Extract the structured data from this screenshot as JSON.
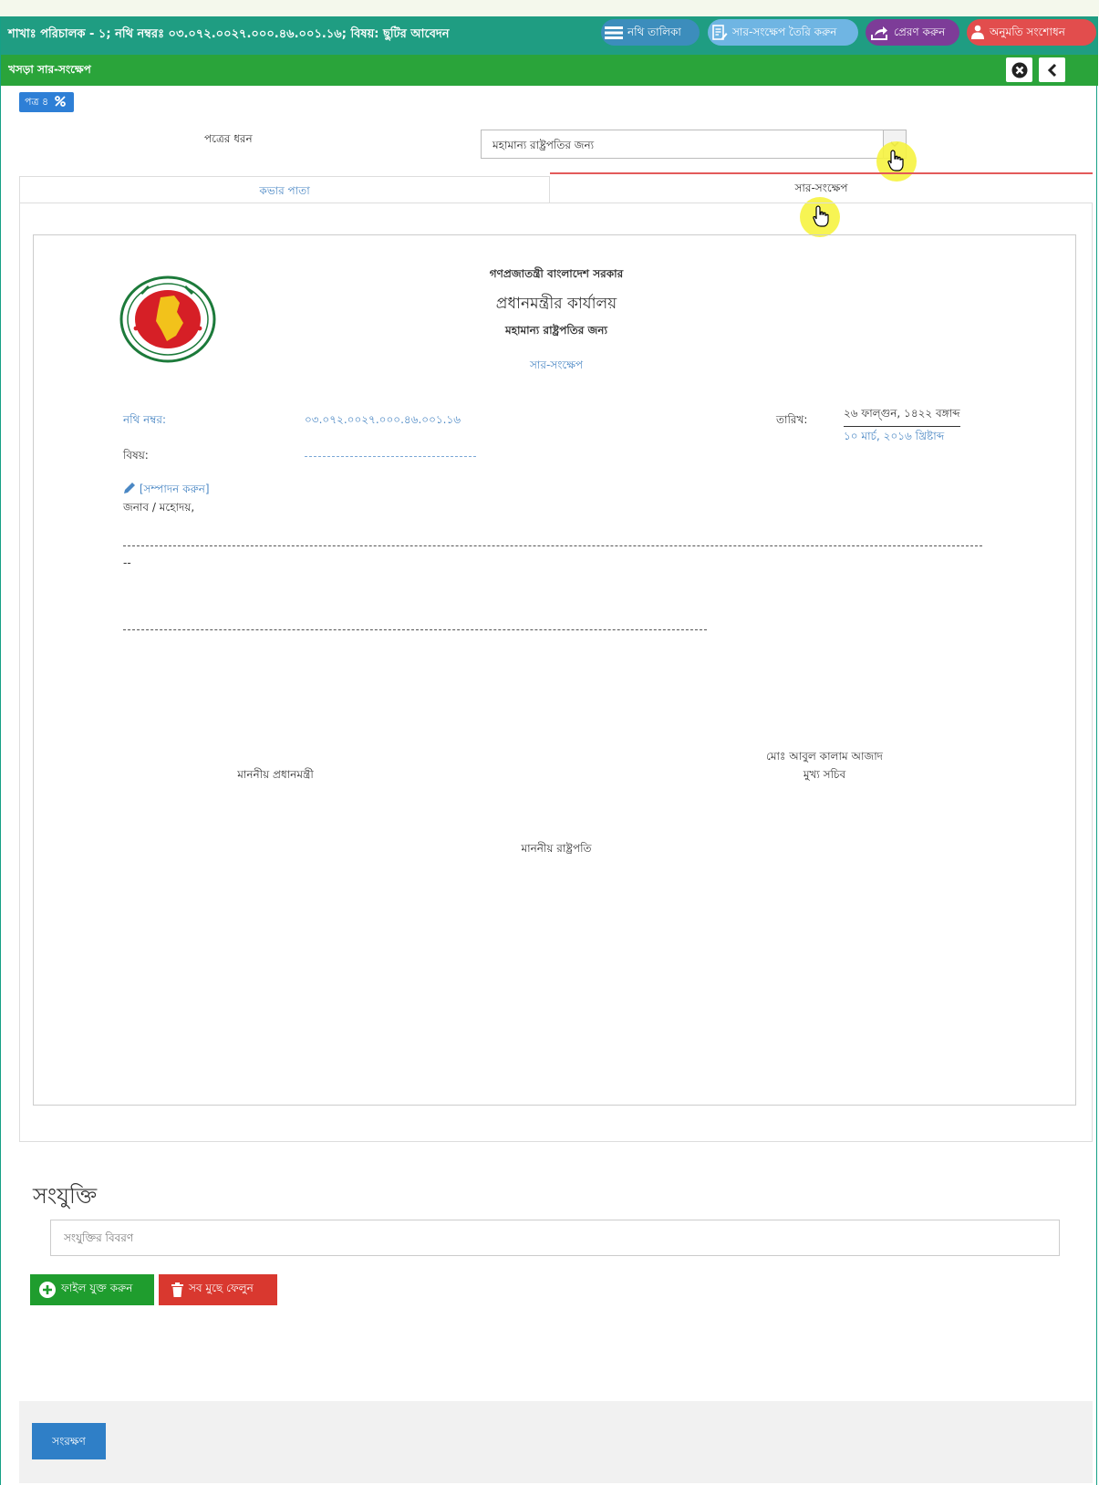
{
  "header": {
    "title": "শাখাঃ পরিচালক - ১; নথি নম্বরঃ ০৩.০৭২.০০২৭.০০০.৪৬.০০১.১৬; বিষয়: ছুটির আবেদন",
    "buttons": {
      "list": "নথি তালিকা",
      "create": "সার-সংক্ষেপ তৈরি করুন",
      "send": "প্রেরণ করুন",
      "permission": "অনুমতি সংশোধন"
    }
  },
  "subbar": {
    "title": "খসড়া সার-সংক্ষেপ"
  },
  "badge": {
    "label": "পত্র ৪"
  },
  "letter_type": {
    "label": "পত্রের ধরন",
    "selected": "মহামান্য রাষ্ট্রপতির জন্য"
  },
  "tabs": {
    "cover": "কভার পাতা",
    "summary": "সার-সংক্ষেপ"
  },
  "document": {
    "gov": "গণপ্রজাতন্ত্রী বাংলাদেশ সরকার",
    "office": "প্রধানমন্ত্রীর কার্যালয়",
    "for_whom": "মহামান্য রাষ্ট্রপতির জন্য",
    "doc_type": "সার-সংক্ষেপ",
    "file_no_label": "নথি নম্বর:",
    "file_no": "০৩.০৭২.০০২৭.০০০.৪৬.০০১.১৬",
    "date_label": "তারিখ:",
    "date_bangla": "২৬ ফাল্গুন, ১৪২২ বঙ্গাব্দ",
    "date_english": "১০ মার্চ, ২০১৬ খ্রিষ্টাব্দ",
    "subject_label": "বিষয়:",
    "edit_link": "[সম্পাদন করুন]",
    "salutation": "জনাব / মহোদয়,",
    "dashes_small": "--",
    "signer_name": "মোঃ আবুল কালাম আজাদ",
    "signer_title": "মুখ্য সচিব",
    "pm": "মাননীয় প্রধানমন্ত্রী",
    "president": "মাননীয় রাষ্ট্রপতি"
  },
  "attachments": {
    "title": "সংযুক্তি",
    "placeholder": "সংযুক্তির বিবরণ",
    "add_file": "ফাইল যুক্ত করুন",
    "clear_all": "সব মুছে ফেলুন"
  },
  "footer": {
    "save": "সংরক্ষণ"
  },
  "colors": {
    "header": "#1f9d82",
    "subbar": "#2aa43a",
    "tab_active_border": "#e35a5a",
    "link": "#4a87c4",
    "save": "#2f7fc7"
  }
}
